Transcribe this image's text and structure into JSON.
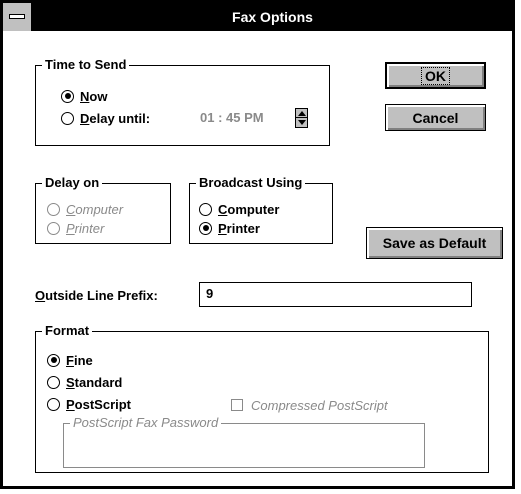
{
  "window": {
    "title": "Fax Options"
  },
  "time_to_send": {
    "label": "Time to Send",
    "now": {
      "accel": "N",
      "rest": "ow",
      "selected": true
    },
    "delay_until": {
      "accel": "D",
      "rest": "elay until:",
      "selected": false
    },
    "time_value": "01 : 45  PM"
  },
  "buttons": {
    "ok": "OK",
    "cancel": "Cancel",
    "save_default": "Save as Default"
  },
  "delay_on": {
    "label": "Delay on",
    "computer": {
      "accel": "C",
      "rest": "omputer"
    },
    "printer": {
      "accel": "P",
      "rest": "rinter"
    }
  },
  "broadcast": {
    "label": "Broadcast Using",
    "computer": {
      "accel": "C",
      "rest": "omputer",
      "selected": false
    },
    "printer": {
      "accel": "P",
      "rest": "rinter",
      "selected": true
    }
  },
  "prefix": {
    "accel": "O",
    "rest": "utside Line Prefix:",
    "value": "9"
  },
  "format": {
    "label": "Format",
    "fine": {
      "accel": "F",
      "rest": "ine",
      "selected": true
    },
    "standard": {
      "accel": "S",
      "rest": "tandard",
      "selected": false
    },
    "postscript": {
      "accel": "P",
      "rest": "ostScript",
      "selected": false
    },
    "compressed": {
      "label": "Compressed PostScript",
      "checked": false
    },
    "password": {
      "label": "PostScript Fax Password",
      "value": ""
    }
  }
}
